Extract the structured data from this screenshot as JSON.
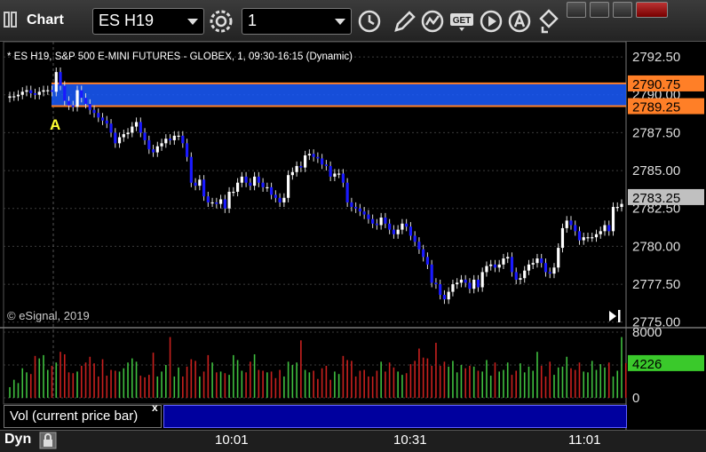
{
  "window": {
    "title": "Chart",
    "symbol": "ES H19",
    "interval": "1"
  },
  "chart_subtitle": "* ES H19, S&P 500 E-MINI FUTURES - GLOBEX, 1, 09:30-16:15 (Dynamic)",
  "copyright": "© eSignal, 2019",
  "marker_label": "A",
  "volume_study_label": "Vol (current price bar)",
  "study_close": "x",
  "footer_label": "Dyn",
  "colors": {
    "up_candle": "#ffffff",
    "down_candle": "#1a1aff",
    "zone_fill": "#1a5cff",
    "zone_border": "#ff7f27",
    "vol_up": "#3fbf3f",
    "vol_down": "#c8201e",
    "last_price_bg": "#c0c0c0",
    "last_volume_bg": "#3ac92b"
  },
  "chart_data": [
    {
      "type": "candlestick",
      "x_ticks": [
        "10:01",
        "10:31",
        "11:01"
      ],
      "y_ticks": [
        "2792.50",
        "2790.00",
        "2787.50",
        "2785.00",
        "2782.50",
        "2780.00",
        "2777.50",
        "2775.00"
      ],
      "ylim": [
        2774.75,
        2793.5
      ],
      "grid": true,
      "zone": {
        "high": 2790.75,
        "low": 2789.25,
        "high_label": "2790.75",
        "low_label": "2789.25"
      },
      "last_price": 2783.25,
      "last_price_label": "2783.25",
      "closes": [
        2789.9,
        2789.9,
        2790.0,
        2790.2,
        2790.3,
        2790.1,
        2790.0,
        2790.2,
        2790.3,
        2790.3,
        2790.2,
        2791.5,
        2790.6,
        2789.6,
        2789.3,
        2789.2,
        2790.3,
        2789.8,
        2789.4,
        2789.0,
        2788.8,
        2788.5,
        2788.3,
        2788.1,
        2787.5,
        2786.8,
        2787.2,
        2787.4,
        2787.5,
        2787.9,
        2788.2,
        2787.5,
        2787.0,
        2786.4,
        2786.2,
        2786.6,
        2786.8,
        2787.1,
        2787.0,
        2787.3,
        2787.3,
        2786.8,
        2785.9,
        2784.2,
        2784.0,
        2784.4,
        2783.3,
        2782.9,
        2782.9,
        2782.8,
        2783.1,
        2782.5,
        2783.6,
        2783.6,
        2784.2,
        2784.6,
        2784.2,
        2784.0,
        2784.6,
        2784.2,
        2783.9,
        2783.9,
        2783.4,
        2783.2,
        2782.9,
        2783.2,
        2784.7,
        2784.9,
        2785.3,
        2785.2,
        2786.0,
        2786.1,
        2785.9,
        2785.8,
        2785.4,
        2785.3,
        2784.6,
        2784.8,
        2784.8,
        2784.2,
        2782.9,
        2782.6,
        2782.5,
        2782.3,
        2782.1,
        2781.8,
        2781.5,
        2781.4,
        2781.9,
        2781.5,
        2781.1,
        2780.8,
        2781.1,
        2781.5,
        2781.3,
        2780.7,
        2780.3,
        2779.8,
        2779.3,
        2778.8,
        2777.6,
        2777.5,
        2776.8,
        2776.5,
        2777.0,
        2777.5,
        2777.6,
        2777.8,
        2777.6,
        2777.2,
        2777.8,
        2777.3,
        2778.3,
        2778.7,
        2778.8,
        2778.6,
        2778.8,
        2779.2,
        2779.3,
        2778.3,
        2777.8,
        2777.9,
        2778.4,
        2778.8,
        2778.9,
        2779.2,
        2778.9,
        2778.3,
        2778.2,
        2778.6,
        2779.9,
        2781.2,
        2781.7,
        2781.4,
        2781.0,
        2780.4,
        2780.6,
        2780.6,
        2780.6,
        2780.8,
        2781.0,
        2781.4,
        2781.0,
        2782.6,
        2782.6,
        2782.8
      ],
      "volume_ylim": [
        0,
        8000
      ],
      "volume_ticks": [
        "8000",
        "0"
      ],
      "last_volume": 4226,
      "last_volume_label": "4226",
      "volumes": [
        1300,
        2200,
        1800,
        3600,
        3100,
        2900,
        5100,
        4800,
        5200,
        3400,
        3900,
        4300,
        5600,
        5300,
        3100,
        3000,
        3200,
        3900,
        4300,
        5000,
        4200,
        2600,
        4700,
        2700,
        3400,
        3300,
        3200,
        3600,
        4300,
        4800,
        4400,
        2700,
        2500,
        2800,
        5500,
        2600,
        3200,
        4000,
        7400,
        2600,
        3700,
        2600,
        3800,
        4700,
        4500,
        2600,
        3200,
        5200,
        4300,
        3100,
        3200,
        3000,
        2800,
        5200,
        4600,
        3300,
        3100,
        4400,
        5300,
        3400,
        3300,
        3100,
        3200,
        2400,
        3400,
        2600,
        4400,
        4000,
        4300,
        7000,
        3400,
        3100,
        3300,
        2300,
        3600,
        3900,
        2200,
        3200,
        2900,
        5100,
        4600,
        4500,
        2600,
        3300,
        3400,
        2600,
        2600,
        3300,
        4400,
        3200,
        4300,
        3700,
        3200,
        2800,
        3000,
        4100,
        4500,
        6000,
        4900,
        4800,
        3900,
        6700,
        3900,
        4400,
        3800,
        4500,
        3100,
        4000,
        3600,
        3900,
        3800,
        3300,
        3200,
        4600,
        2700,
        4300,
        3200,
        3400,
        4300,
        2800,
        3300,
        4200,
        3100,
        3800,
        3300,
        5600,
        3900,
        2600,
        4400,
        2800,
        3700,
        3800,
        5000,
        3600,
        3400,
        4300,
        3200,
        3100,
        4500,
        3400,
        4100,
        3700,
        4300,
        2600,
        3300,
        7400,
        4226
      ]
    }
  ]
}
